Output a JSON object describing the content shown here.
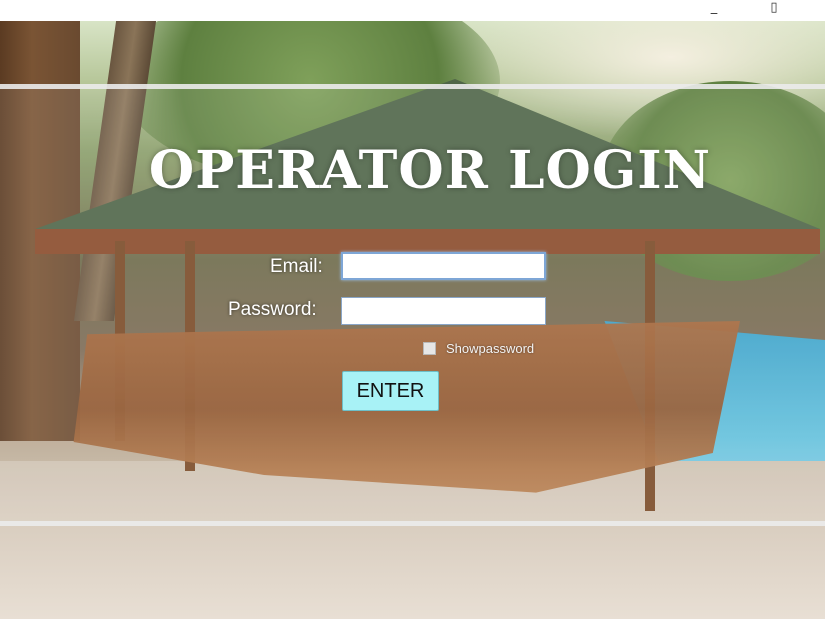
{
  "window": {
    "minimize_glyph": "_",
    "maximize_glyph": "▯"
  },
  "login": {
    "title": "OPERATOR LOGIN",
    "email_label": "Email:",
    "email_value": "",
    "password_label": "Password:",
    "password_value": "",
    "show_password_label": "Showpassword",
    "show_password_checked": false,
    "enter_label": "ENTER"
  },
  "colors": {
    "enter_button": "#a8f2f6",
    "title_text": "#ffffff",
    "focus_border": "#7ea6d6"
  }
}
